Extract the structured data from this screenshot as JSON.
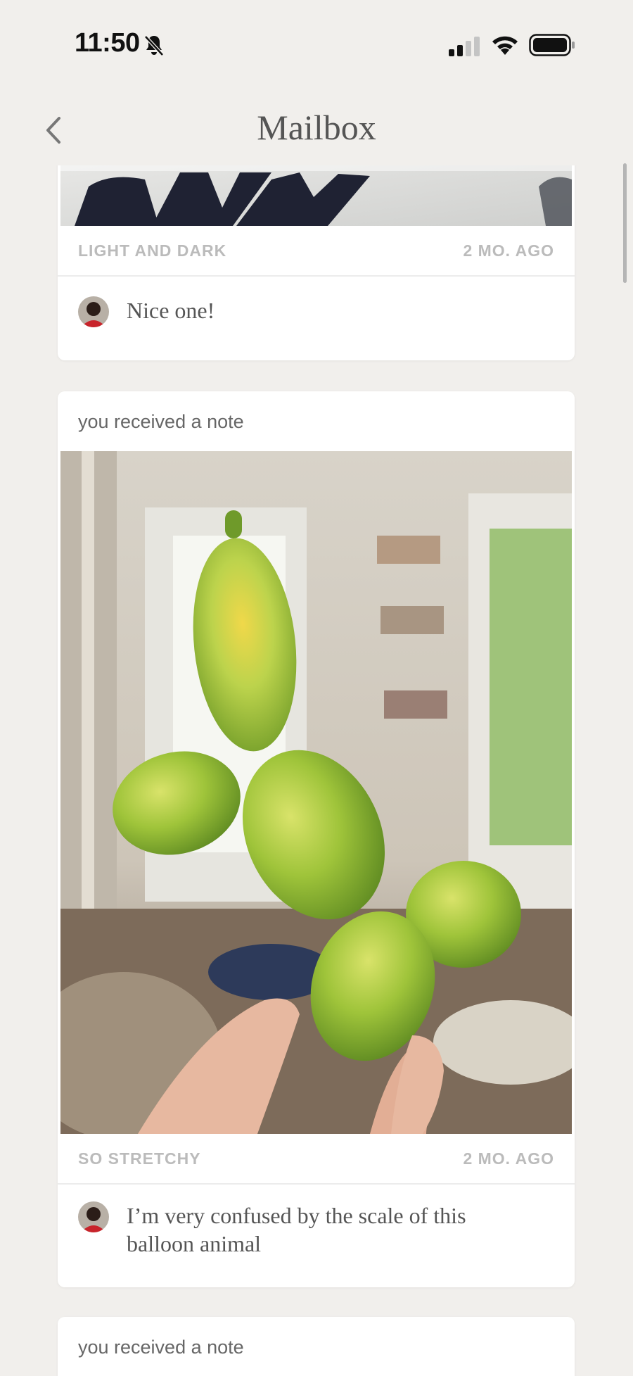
{
  "status_bar": {
    "time": "11:50"
  },
  "header": {
    "title": "Mailbox"
  },
  "cards": [
    {
      "caption": "LIGHT AND DARK",
      "age": "2 MO. AGO",
      "comment": "Nice one!"
    },
    {
      "label": "you received a note",
      "caption": "SO STRETCHY",
      "age": "2 MO. AGO",
      "comment": "I’m very confused by the scale of this balloon animal"
    },
    {
      "label": "you received a note"
    }
  ],
  "icons": {
    "back": "chevron-left-icon",
    "bell": "bell-slash-icon",
    "signal": "cellular-signal-icon",
    "wifi": "wifi-icon",
    "battery": "battery-icon"
  }
}
